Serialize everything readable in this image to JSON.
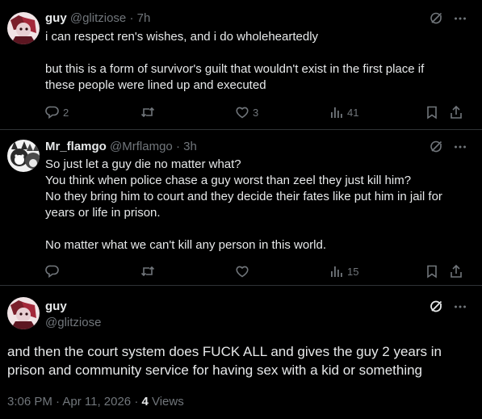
{
  "replies": [
    {
      "name": "guy",
      "handle": "@glitziose",
      "time": "7h",
      "paragraphs": [
        "i can respect ren's wishes, and i do wholeheartedly",
        "but this is a form of survivor's guilt that wouldn't exist in the first place if\nthese people were lined up and executed"
      ],
      "replies_count": "2",
      "reposts_count": "",
      "likes_count": "3",
      "views_count": "41"
    },
    {
      "name": "Mr_flamgo",
      "handle": "@Mrflamgo",
      "time": "3h",
      "paragraphs": [
        "So just let a guy die no matter what?\nYou think when police chase a guy worst than zeel they just kill him?\nNo they bring him to court and they decide their fates like put him in jail for\nyears or life in prison.",
        "No matter what we can't kill any person in this world."
      ],
      "replies_count": "",
      "reposts_count": "",
      "likes_count": "",
      "views_count": "15"
    }
  ],
  "main": {
    "name": "guy",
    "handle": "@glitziose",
    "text": "and then the court system does FUCK ALL and gives the guy 2 years in\nprison and community service for having sex with a kid or something",
    "timestamp": "3:06 PM · Apr 11, 2026 · ",
    "views_count": "4",
    "views_label": " Views"
  },
  "separator": "·",
  "colors": {
    "background": "#000000",
    "text": "#e7e9ea",
    "muted": "#71767b",
    "divider": "#2f3336"
  },
  "icons": [
    "no-grok-icon",
    "more-icon",
    "reply-icon",
    "repost-icon",
    "like-icon",
    "views-icon",
    "bookmark-icon",
    "share-icon"
  ]
}
